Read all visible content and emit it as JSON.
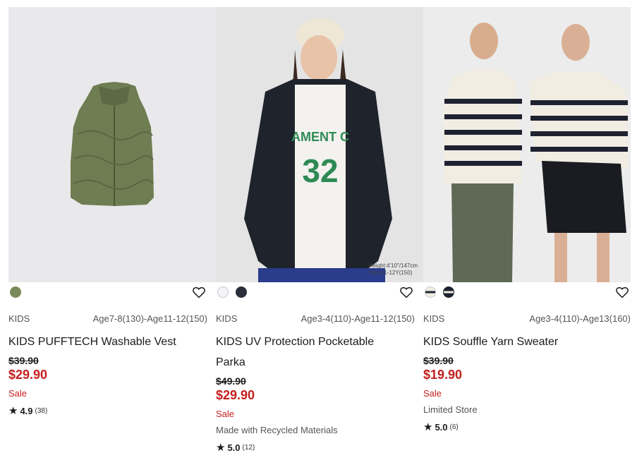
{
  "products": [
    {
      "category": "KIDS",
      "sizes": "Age7-8(130)-Age11-12(150)",
      "name": "KIDS PUFFTECH Washable Vest",
      "original_price": "$39.90",
      "price": "$29.90",
      "sale_label": "Sale",
      "note": "",
      "rating": "4.9",
      "review_count": "(38)",
      "swatches": [
        "#7a8a5a"
      ]
    },
    {
      "category": "KIDS",
      "sizes": "Age3-4(110)-Age11-12(150)",
      "name_line1": "KIDS UV Protection Pocketable",
      "name_line2": "Parka",
      "original_price": "$49.90",
      "price": "$29.90",
      "sale_label": "Sale",
      "note": "Made with Recycled Materials",
      "rating": "5.0",
      "review_count": "(12)",
      "image_caption_line1": "Height:4'10\"/147cm",
      "image_caption_line2": "Size:11-12Y(150)",
      "swatches": [
        "#f4f4f8",
        "#2b2f3a"
      ]
    },
    {
      "category": "KIDS",
      "sizes": "Age3-4(110)-Age13(160)",
      "name": "KIDS Souffle Yarn Sweater",
      "original_price": "$39.90",
      "price": "$19.90",
      "sale_label": "Sale",
      "note": "Limited Store",
      "rating": "5.0",
      "review_count": "(6)",
      "swatches": [
        "#f2ede2",
        "#1d2330"
      ]
    }
  ]
}
